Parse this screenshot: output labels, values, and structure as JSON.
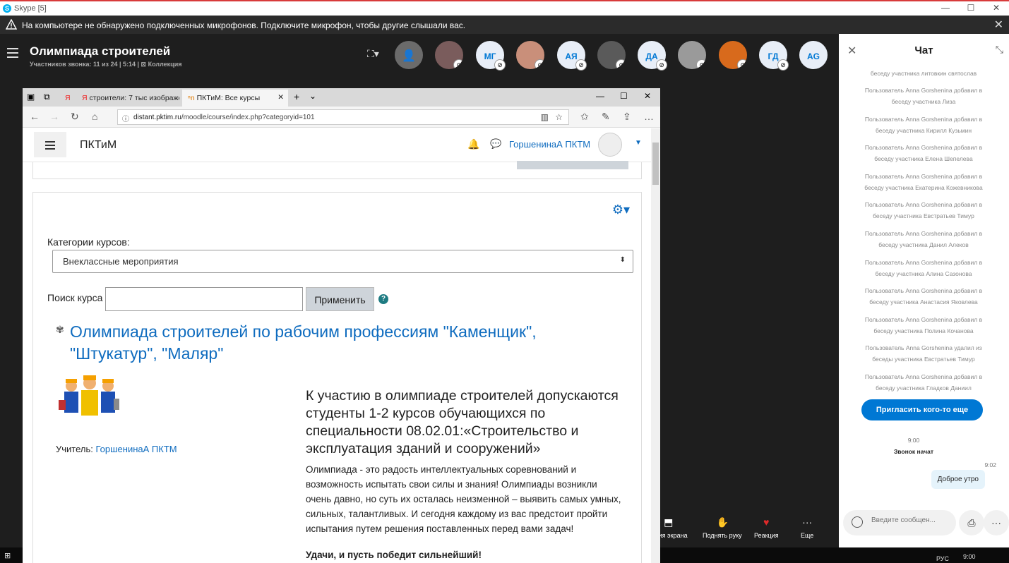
{
  "window": {
    "title": "Skype [5]",
    "min": "—",
    "max": "☐",
    "close": "✕"
  },
  "warning": {
    "text": "На компьютере не обнаружено подключенных микрофонов. Подключите микрофон, чтобы другие слышали вас.",
    "close": "✕"
  },
  "call": {
    "title": "Олимпиада строителей",
    "subtitle": "Участников звонка: 11 из 24 | 5:14 | ⊠ Коллекция",
    "participants": [
      "МГ",
      "АЯ",
      "ДА",
      "ГД",
      "AG"
    ]
  },
  "controls": [
    {
      "label": "...ция экрана",
      "icon": "⬒"
    },
    {
      "label": "Поднять руку",
      "icon": "✋"
    },
    {
      "label": "Реакция",
      "icon": "♥"
    },
    {
      "label": "Еще",
      "icon": "···"
    }
  ],
  "browser": {
    "tabs": [
      "Я",
      "строители: 7 тыс изображе",
      "ПКТиМ: Все курсы"
    ],
    "url_host": "distant.pktim.ru",
    "url_path": "/moodle/course/index.php?categoryid=101"
  },
  "moodle": {
    "site_name": "ПКТиМ",
    "user_name": "ГоршенинаА ПКТМ",
    "categories_label": "Категории курсов:",
    "category_selected": "Внеклассные мероприятия",
    "search_label": "Поиск курса",
    "apply_label": "Применить",
    "course_title": "Олимпиада строителей по рабочим профессиям \"Каменщик\", \"Штукатур\", \"Маляр\"",
    "teacher_label": "Учитель: ",
    "teacher_name": "ГоршенинаА ПКТМ",
    "summary": "К участию в олимпиаде строителей допускаются студенты 1-2 курсов обучающихся по специальности 08.02.01:«Строительство и эксплуатация зданий и сооружений»",
    "description": "Олимпиада - это радость интеллектуальных соревнований и возможность испытать свои силы и знания! Олимпиады возникли очень давно, но суть их осталась неизменной – выявить самых умных, сильных, талантливых. И сегодня каждому из вас предстоит пройти испытания путем решения поставленных перед вами задач!",
    "luck": "Удачи, и пусть победит сильнейший!"
  },
  "chat": {
    "title": "Чат",
    "messages": [
      "беседу участника литовкин святослав",
      "Пользователь Anna Gorshenina добавил в беседу участника Лиза",
      "Пользователь Anna Gorshenina добавил в беседу участника Кирилл Кузьмин",
      "Пользователь Anna Gorshenina добавил в беседу участника Елена Шепелева",
      "Пользователь Anna Gorshenina добавил в беседу участника Екатерина Кожевникова",
      "Пользователь Anna Gorshenina добавил в беседу участника Евстратьев Тимур",
      "Пользователь Anna Gorshenina добавил в беседу участника Данил Алеков",
      "Пользователь Anna Gorshenina добавил в беседу участника Алина Сазонова",
      "Пользователь Anna Gorshenina добавил в беседу участника Анастасия Яковлева",
      "Пользователь Anna Gorshenina добавил в беседу участника Полина Кочанова",
      "Пользователь Anna Gorshenina удалил из беседы участника Евстратьев Тимур",
      "Пользователь Anna Gorshenina добавил в беседу участника Гладков Даниил"
    ],
    "invite_label": "Пригласить кого-то еще",
    "time1": "9:00",
    "call_started": "Звонок начат",
    "time2": "9:02",
    "bubble": "Доброе утро",
    "composer_placeholder": "Введите сообщен..."
  },
  "taskbar": {
    "lang": "РУС",
    "time": "9:00"
  }
}
